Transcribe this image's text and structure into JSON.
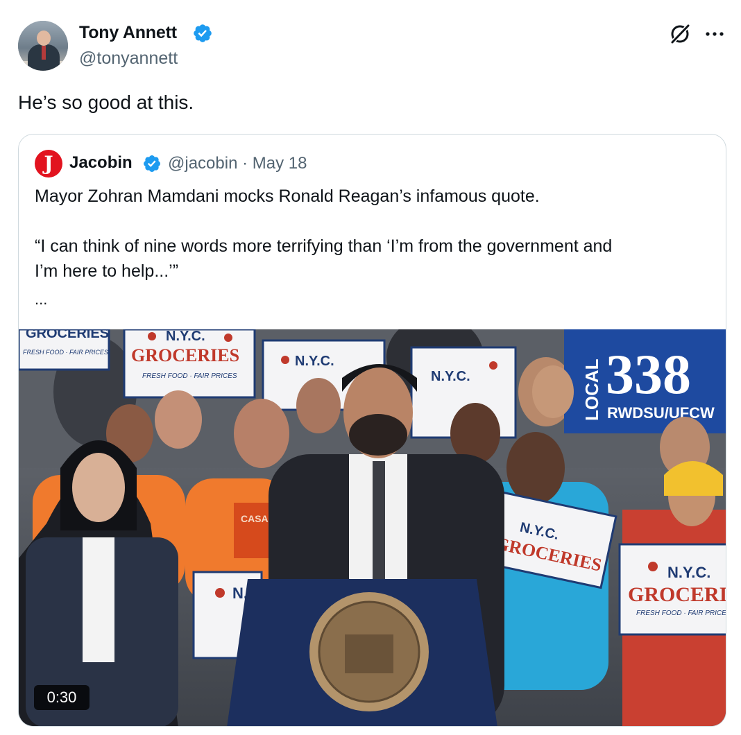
{
  "tweet": {
    "author_name": "Tony Annett",
    "author_handle": "@tonyannett",
    "text": "He’s so good at this."
  },
  "quoted": {
    "author_name": "Jacobin",
    "avatar_letter": "J",
    "meta": "@jacobin · May 18",
    "line1": "Mayor Zohran Mamdani mocks Ronald Reagan’s infamous quote.",
    "line2": "“I can think of nine words more terrifying than ‘I’m from the government and",
    "line3": "I’m here to help...’”",
    "more": "...",
    "video": {
      "duration": "0:30",
      "signs": {
        "nyc": "N.Y.C.",
        "groceries": "GROCERIES",
        "tagline": "FRESH FOOD · FAIR PRICES",
        "local": "LOCAL",
        "local_number": "338",
        "union": "RWDSU/UFCW",
        "shirt": "CASA"
      }
    }
  },
  "colors": {
    "verified": "#1d9bf0",
    "jacobin_red": "#e2131f",
    "sign_red": "#c0392b",
    "sign_blue": "#1f3b73",
    "union_blue": "#1e4aa0",
    "shirt_orange": "#f07a2d",
    "podium_blue": "#1c2f5e"
  },
  "icons": [
    "verified-badge-icon",
    "grok-icon",
    "more-icon",
    "play-duration-badge"
  ]
}
